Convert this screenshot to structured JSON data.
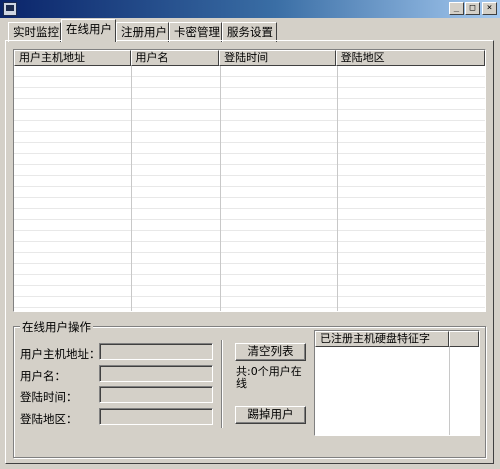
{
  "window": {
    "minimize_glyph": "_",
    "maximize_glyph": "□",
    "close_glyph": "×"
  },
  "tabs": [
    {
      "label": "实时监控"
    },
    {
      "label": "在线用户"
    },
    {
      "label": "注册用户"
    },
    {
      "label": "卡密管理"
    },
    {
      "label": "服务设置"
    }
  ],
  "active_tab": "在线用户",
  "online_list": {
    "columns": [
      "用户主机地址",
      "用户名",
      "登陆时间",
      "登陆地区"
    ],
    "rows": []
  },
  "operations": {
    "group_title": "在线用户操作",
    "host_label": "用户主机地址：",
    "host_value": "",
    "username_label": "用户名：",
    "username_value": "",
    "login_time_label": "登陆时间：",
    "login_time_value": "",
    "region_label": "登陆地区：",
    "region_value": "",
    "clear_button": "清空列表",
    "count_status": "共:0个用户在线",
    "kick_button": "踢掉用户"
  },
  "hw_list": {
    "columns": [
      "已注册主机硬盘特征字",
      ""
    ],
    "rows": []
  }
}
